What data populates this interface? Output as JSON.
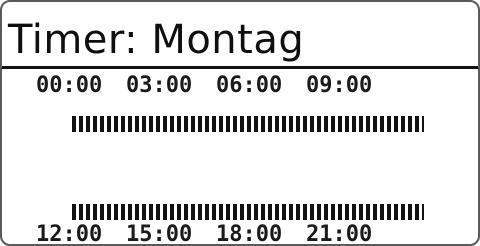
{
  "screen": {
    "title": "Timer: Montag",
    "top_times": [
      "00:00",
      "03:00",
      "06:00",
      "09:00"
    ],
    "bottom_times": [
      "12:00",
      "15:00",
      "18:00",
      "21:00"
    ]
  },
  "colors": {
    "background": "#ffffff",
    "foreground": "#111111",
    "frame": "#5a5a5a"
  }
}
